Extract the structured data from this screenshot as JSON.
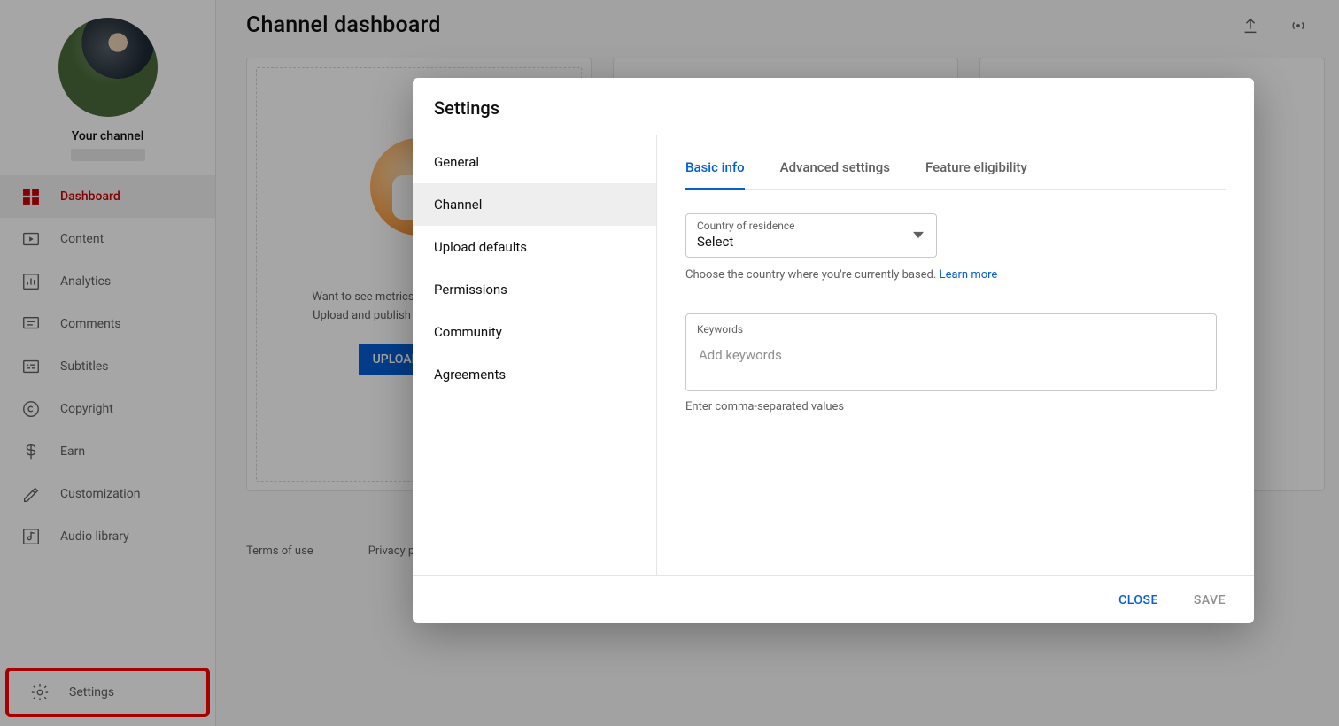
{
  "sidebar": {
    "channel_label": "Your channel",
    "items": [
      {
        "label": "Dashboard"
      },
      {
        "label": "Content"
      },
      {
        "label": "Analytics"
      },
      {
        "label": "Comments"
      },
      {
        "label": "Subtitles"
      },
      {
        "label": "Copyright"
      },
      {
        "label": "Earn"
      },
      {
        "label": "Customization"
      },
      {
        "label": "Audio library"
      }
    ],
    "settings_label": "Settings"
  },
  "header": {
    "title": "Channel dashboard"
  },
  "card": {
    "line1": "Want to see metrics on your recent video?",
    "line2": "Upload and publish a video to get started.",
    "upload_button": "UPLOAD VIDEOS"
  },
  "footer": {
    "terms": "Terms of use",
    "privacy": "Privacy policy"
  },
  "modal": {
    "title": "Settings",
    "side_items": [
      {
        "label": "General"
      },
      {
        "label": "Channel"
      },
      {
        "label": "Upload defaults"
      },
      {
        "label": "Permissions"
      },
      {
        "label": "Community"
      },
      {
        "label": "Agreements"
      }
    ],
    "tabs": [
      {
        "label": "Basic info"
      },
      {
        "label": "Advanced settings"
      },
      {
        "label": "Feature eligibility"
      }
    ],
    "country": {
      "label": "Country of residence",
      "value": "Select",
      "helper": "Choose the country where you're currently based.",
      "learn_more": "Learn more"
    },
    "keywords": {
      "label": "Keywords",
      "placeholder": "Add keywords",
      "helper": "Enter comma-separated values"
    },
    "close": "CLOSE",
    "save": "SAVE"
  }
}
